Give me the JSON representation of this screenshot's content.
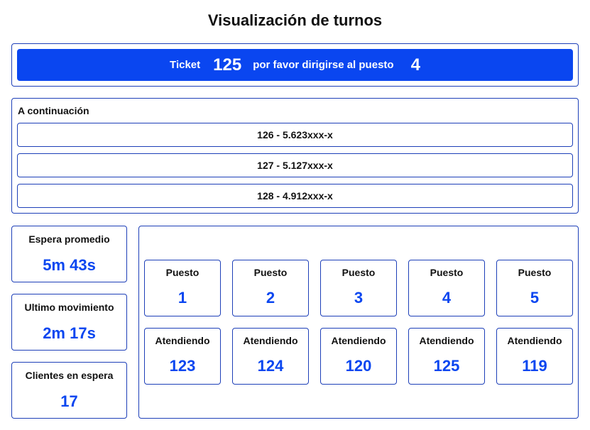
{
  "page": {
    "title": "Visualización de turnos"
  },
  "call": {
    "ticket_label": "Ticket",
    "ticket_number": "125",
    "message": "por favor dirigirse al puesto",
    "station_number": "4"
  },
  "queue": {
    "title": "A continuación",
    "items": [
      "126 - 5.623xxx-x",
      "127 - 5.127xxx-x",
      "128 - 4.912xxx-x"
    ]
  },
  "stats": [
    {
      "label": "Espera promedio",
      "value": "5m 43s"
    },
    {
      "label": "Ultimo movimiento",
      "value": "2m 17s"
    },
    {
      "label": "Clientes en espera",
      "value": "17"
    }
  ],
  "stations": [
    {
      "label": "Puesto",
      "number": "1",
      "attending_label": "Atendiendo",
      "attending": "123"
    },
    {
      "label": "Puesto",
      "number": "2",
      "attending_label": "Atendiendo",
      "attending": "124"
    },
    {
      "label": "Puesto",
      "number": "3",
      "attending_label": "Atendiendo",
      "attending": "120"
    },
    {
      "label": "Puesto",
      "number": "4",
      "attending_label": "Atendiendo",
      "attending": "125"
    },
    {
      "label": "Puesto",
      "number": "5",
      "attending_label": "Atendiendo",
      "attending": "119"
    }
  ],
  "colors": {
    "accent": "#0a46f0",
    "border": "#1d3fb8",
    "text": "#111111"
  }
}
